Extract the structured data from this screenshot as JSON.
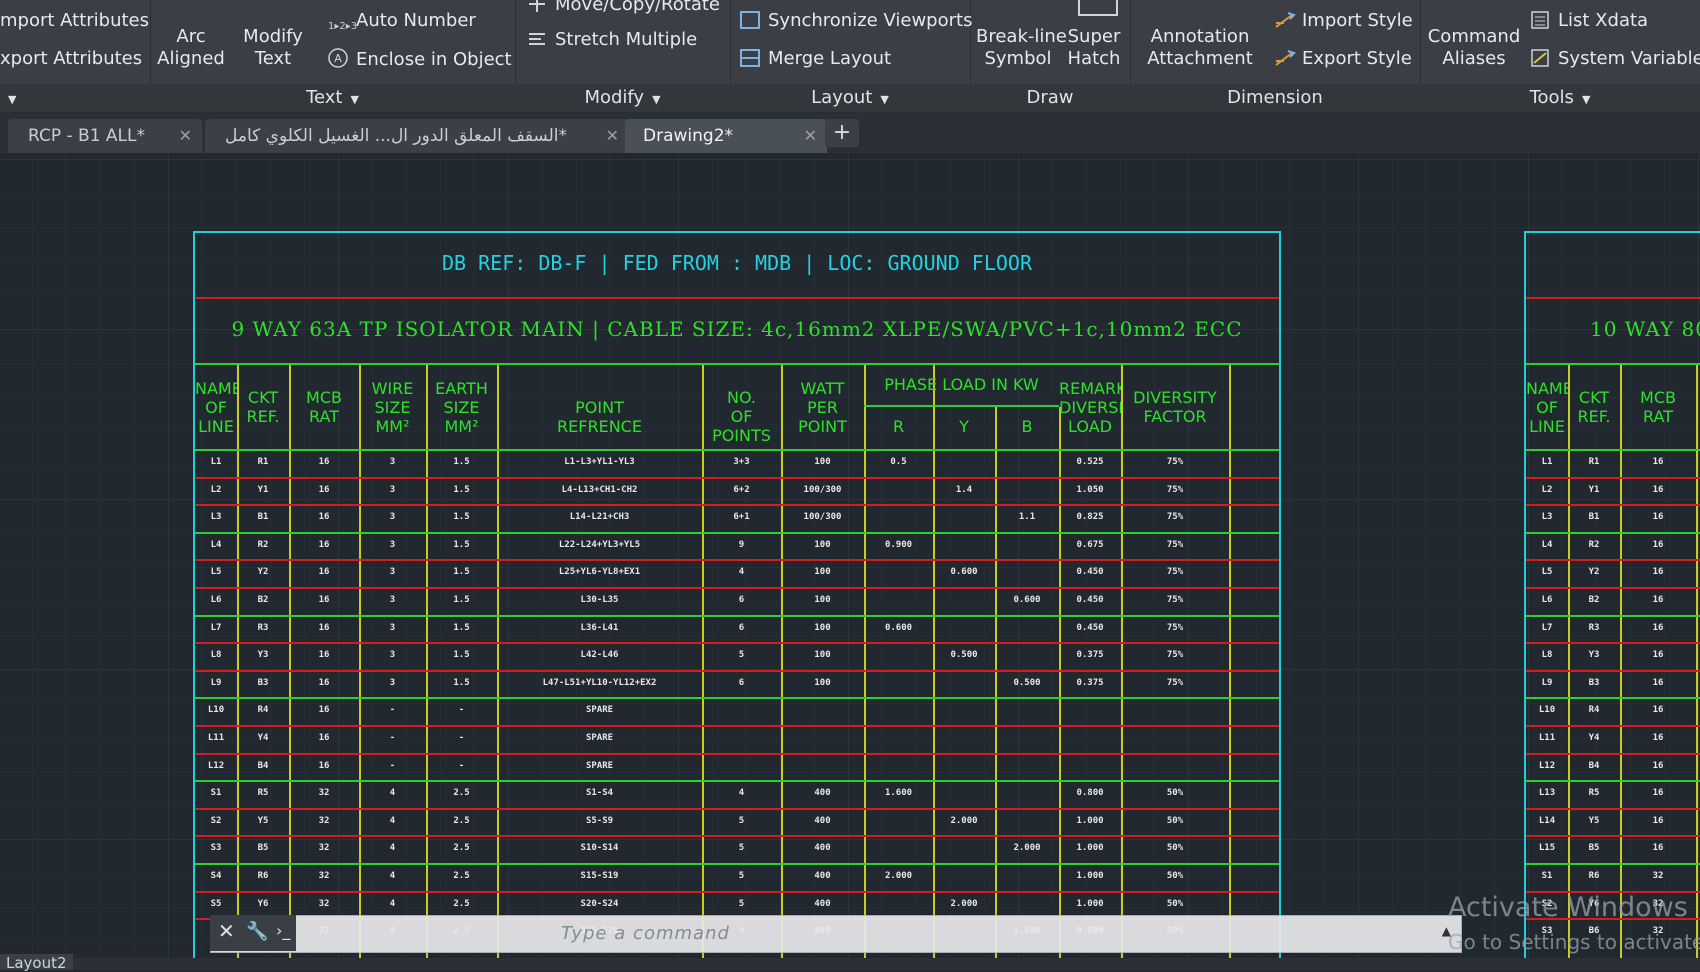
{
  "ribbon": {
    "panels": [
      {
        "id": "text",
        "title": "Text",
        "has_dropdown": true
      },
      {
        "id": "modify",
        "title": "Modify",
        "has_dropdown": true
      },
      {
        "id": "layout",
        "title": "Layout",
        "has_dropdown": true
      },
      {
        "id": "draw",
        "title": "Draw",
        "has_dropdown": false
      },
      {
        "id": "dimension",
        "title": "Dimension",
        "has_dropdown": false
      },
      {
        "id": "tools",
        "title": "Tools",
        "has_dropdown": true
      }
    ],
    "buttons": {
      "import_attributes": "mport Attributes",
      "export_attributes": "xport Attributes",
      "arc_aligned_1": "Arc",
      "arc_aligned_2": "Aligned",
      "modify_text_1": "Modify",
      "modify_text_2": "Text",
      "auto_number": "Auto Number",
      "enclose_in_object": "Enclose in Object",
      "move_copy_rotate": "Move/Copy/Rotate",
      "stretch_multiple": "Stretch Multiple",
      "synchronize_viewports": "Synchronize Viewports",
      "merge_layout": "Merge Layout",
      "break_line_1": "Break-line",
      "break_line_2": "Symbol",
      "super_hatch_1": "Super",
      "super_hatch_2": "Hatch",
      "annotation_1": "Annotation",
      "annotation_2": "Attachment",
      "import_style": "Import Style",
      "export_style": "Export Style",
      "command_aliases_1": "Command",
      "command_aliases_2": "Aliases",
      "list_xdata": "List Xdata",
      "system_variables": "System Variables"
    }
  },
  "tabs": [
    {
      "label": "RCP - B1 ALL*",
      "active": false
    },
    {
      "label": "السقف المعلق الدور ال... الغسيل الكلوي كامل*",
      "active": false
    },
    {
      "label": "Drawing2*",
      "active": true
    }
  ],
  "schedule_left": {
    "db_ref": "DB REF: DB-F | FED FROM : MDB | LOC: GROUND FLOOR",
    "main_spec": "9 WAY 63A TP ISOLATOR MAIN | CABLE SIZE: 4c,16mm2 XLPE/SWA/PVC+1c,10mm2 ECC",
    "headers": {
      "name_of_line": "NAME OF LINE",
      "ckt_ref": "CKT REF.",
      "mcb_rat": "MCB RAT",
      "wire_size": "WIRE SIZE MM²",
      "earth_size": "EARTH SIZE MM²",
      "point_ref": "POINT REFRENCE",
      "no_points": "NO. OF POINTS",
      "watt_per_point": "WATT PER POINT",
      "phase_load": "PHASE LOAD IN KW",
      "r": "R",
      "y": "Y",
      "b": "B",
      "remarks": "REMARKS DIVERSITY LOAD",
      "diversity": "DIVERSITY FACTOR"
    },
    "rows": [
      [
        "L1",
        "R1",
        "16",
        "3",
        "1.5",
        "L1-L3+YL1-YL3",
        "3+3",
        "100",
        "0.5",
        "",
        "",
        "0.525",
        "75%"
      ],
      [
        "L2",
        "Y1",
        "16",
        "3",
        "1.5",
        "L4-L13+CH1-CH2",
        "6+2",
        "100/300",
        "",
        "1.4",
        "",
        "1.050",
        "75%"
      ],
      [
        "L3",
        "B1",
        "16",
        "3",
        "1.5",
        "L14-L21+CH3",
        "6+1",
        "100/300",
        "",
        "",
        "1.1",
        "0.825",
        "75%"
      ],
      [
        "L4",
        "R2",
        "16",
        "3",
        "1.5",
        "L22-L24+YL3+YL5",
        "9",
        "100",
        "0.900",
        "",
        "",
        "0.675",
        "75%"
      ],
      [
        "L5",
        "Y2",
        "16",
        "3",
        "1.5",
        "L25+YL6-YL8+EX1",
        "4",
        "100",
        "",
        "0.600",
        "",
        "0.450",
        "75%"
      ],
      [
        "L6",
        "B2",
        "16",
        "3",
        "1.5",
        "L30-L35",
        "6",
        "100",
        "",
        "",
        "0.600",
        "0.450",
        "75%"
      ],
      [
        "L7",
        "R3",
        "16",
        "3",
        "1.5",
        "L36-L41",
        "6",
        "100",
        "0.600",
        "",
        "",
        "0.450",
        "75%"
      ],
      [
        "L8",
        "Y3",
        "16",
        "3",
        "1.5",
        "L42-L46",
        "5",
        "100",
        "",
        "0.500",
        "",
        "0.375",
        "75%"
      ],
      [
        "L9",
        "B3",
        "16",
        "3",
        "1.5",
        "L47-L51+YL10-YL12+EX2",
        "6",
        "100",
        "",
        "",
        "0.500",
        "0.375",
        "75%"
      ],
      [
        "L10",
        "R4",
        "16",
        "-",
        "-",
        "SPARE",
        "",
        "",
        "",
        "",
        "",
        "",
        ""
      ],
      [
        "L11",
        "Y4",
        "16",
        "-",
        "-",
        "SPARE",
        "",
        "",
        "",
        "",
        "",
        "",
        ""
      ],
      [
        "L12",
        "B4",
        "16",
        "-",
        "-",
        "SPARE",
        "",
        "",
        "",
        "",
        "",
        "",
        ""
      ],
      [
        "S1",
        "R5",
        "32",
        "4",
        "2.5",
        "S1-S4",
        "4",
        "400",
        "1.600",
        "",
        "",
        "0.800",
        "50%"
      ],
      [
        "S2",
        "Y5",
        "32",
        "4",
        "2.5",
        "S5-S9",
        "5",
        "400",
        "",
        "2.000",
        "",
        "1.000",
        "50%"
      ],
      [
        "S3",
        "B5",
        "32",
        "4",
        "2.5",
        "S10-S14",
        "5",
        "400",
        "",
        "",
        "2.000",
        "1.000",
        "50%"
      ],
      [
        "S4",
        "R6",
        "32",
        "4",
        "2.5",
        "S15-S19",
        "5",
        "400",
        "2.000",
        "",
        "",
        "1.000",
        "50%"
      ],
      [
        "S5",
        "Y6",
        "32",
        "4",
        "2.5",
        "S20-S24",
        "5",
        "400",
        "",
        "2.000",
        "",
        "1.000",
        "50%"
      ],
      [
        "S6",
        "B6",
        "32",
        "4",
        "2.5",
        "S25-S28",
        "4",
        "400",
        "",
        "",
        "1.600",
        "0.800",
        "50%"
      ]
    ]
  },
  "schedule_right": {
    "main_spec": "10 WAY 80",
    "headers": {
      "name_of_line": "NAME OF LINE",
      "ckt_ref": "CKT REF.",
      "mcb_rat": "MCB RAT"
    },
    "rows": [
      [
        "L1",
        "R1",
        "16"
      ],
      [
        "L2",
        "Y1",
        "16"
      ],
      [
        "L3",
        "B1",
        "16"
      ],
      [
        "L4",
        "R2",
        "16"
      ],
      [
        "L5",
        "Y2",
        "16"
      ],
      [
        "L6",
        "B2",
        "16"
      ],
      [
        "L7",
        "R3",
        "16"
      ],
      [
        "L8",
        "Y3",
        "16"
      ],
      [
        "L9",
        "B3",
        "16"
      ],
      [
        "L10",
        "R4",
        "16"
      ],
      [
        "L11",
        "Y4",
        "16"
      ],
      [
        "L12",
        "B4",
        "16"
      ],
      [
        "L13",
        "R5",
        "16"
      ],
      [
        "L14",
        "Y5",
        "16"
      ],
      [
        "L15",
        "B5",
        "16"
      ],
      [
        "S1",
        "R6",
        "32"
      ],
      [
        "S2",
        "Y6",
        "32"
      ],
      [
        "S3",
        "B6",
        "32"
      ]
    ]
  },
  "command_line": {
    "placeholder": "Type a command"
  },
  "watermark": {
    "line1": "Activate Windows",
    "line2": "Go to Settings to activate"
  },
  "status": {
    "layout_tab": "Layout2"
  },
  "colors": {
    "cyan": "#1fd1d6",
    "green": "#2fe02a",
    "red": "#d11f1f",
    "yellow": "#c8cc1e",
    "ribbon": "#3b3f45",
    "canvas": "#212830"
  }
}
